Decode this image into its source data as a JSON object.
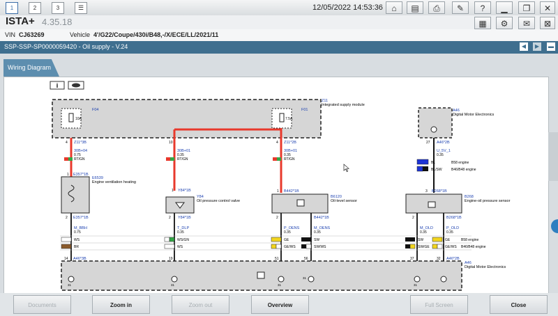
{
  "toolbar": {
    "tabs": [
      "1",
      "2",
      "3"
    ],
    "datetime": "12/05/2022 14:53:36"
  },
  "app": {
    "name": "ISTA+",
    "version": "4.35.18"
  },
  "vehicle": {
    "vin_label": "VIN",
    "vin": "CJ63269",
    "vehicle_label": "Vehicle",
    "vehicle": "4'/G22/Coupe/430i/B48,-/X/ECE/LL/2021/11"
  },
  "document": {
    "title": "SSP-SSP-SP0000059420 - Oil supply - V.24"
  },
  "view_tab": "Wiring Diagram",
  "diagram": {
    "z11_id": "Z11",
    "z11_name": "Integrated supply module",
    "f04": "F04",
    "f04_rating": "10A",
    "f01": "F01",
    "f01_rating": "7.5A",
    "a46": "A46",
    "a46_name": "Digital Motor Electronics",
    "pin_a": [
      "4",
      "Z11*3B",
      "30B+04",
      "0.75",
      "RT/GN"
    ],
    "pin_b": [
      "10",
      "30B+01",
      "0.35",
      "RT/GN"
    ],
    "pin_c": [
      "4",
      "Z11*2B",
      "30B+01",
      "0.35",
      "RT/GN"
    ],
    "pin_d": [
      "27",
      "A46*2B",
      "U_5V_1",
      "0.35"
    ],
    "b58_bl": "BL",
    "b58_engine": "B58 engine",
    "b46_blsw": "BL/SW",
    "b46_engine": "B46/B48 engine",
    "e6539": "E6539",
    "e6539_name": "Engine ventilation heating",
    "e6539_conn": "E357*1B",
    "y84": "Y84",
    "y84_name": "Oil pressure control valve",
    "y84_conn": "Y84*1B",
    "b6120": "B6120",
    "b6120_name": "Oil-level sensor",
    "b6120_conn": "B442*1B",
    "b268": "B268",
    "b268_name": "Engine-oil pressure sensor",
    "b268_conn": "B268*1B",
    "e_conn2": "E357*1B",
    "y_conn2": "Y84*1B",
    "b442_conn2": "B442*1B",
    "b268_conn2": "B268*1B",
    "sig1": "M_BBH",
    "sig1b": "0.75",
    "sig2": "T_DLP",
    "sig2b": "0.35",
    "sig3": "P_OENS",
    "sig3b": "0.35",
    "sig4": "M_OENS",
    "sig4b": "0.35",
    "sig5": "M_OLD",
    "sig5b": "0.35",
    "sig6": "P_OLD",
    "sig6b": "0.35",
    "row1": [
      "WS",
      "WS/GN",
      "GE",
      "SW",
      "SW",
      "GE"
    ],
    "row2": [
      "BR",
      "WS",
      "GE/WS",
      "SW/WS",
      "SW/GE",
      "GE/WS"
    ],
    "b58_label2": "B58 engine",
    "b46_label2": "B46/B48 engine",
    "dme_pins": [
      "14",
      "19",
      "51",
      "56",
      "37",
      "32"
    ],
    "dme_conn1": "A46*3B",
    "dme_conn2": "A46*2B",
    "pin_misc": [
      "1",
      "2",
      "1",
      "2",
      "2",
      "1",
      "2",
      "3",
      "1",
      "2",
      "1",
      "31",
      "31",
      "31",
      "31",
      "31"
    ]
  },
  "buttons": {
    "documents": "Documents",
    "zoom_in": "Zoom in",
    "zoom_out": "Zoom out",
    "overview": "Overview",
    "full_screen": "Full Screen",
    "close": "Close"
  }
}
